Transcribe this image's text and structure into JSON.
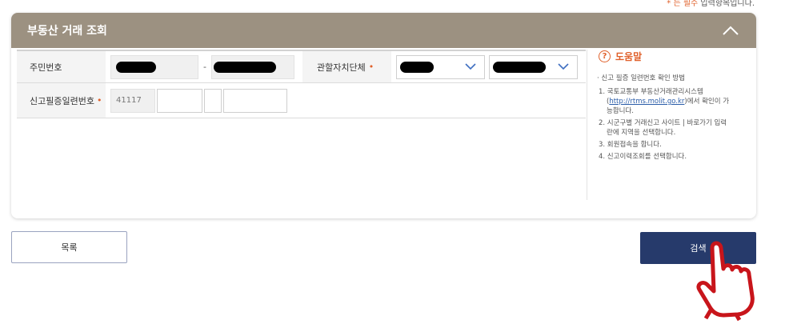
{
  "required_note": {
    "prefix": "* 는 ",
    "emphasis": "필수",
    "suffix": " 입력항목입니다."
  },
  "panel": {
    "title": "부동산 거래 조회"
  },
  "form": {
    "rrn_label": "주민번호",
    "rrn_dash": "-",
    "authority_label": "관할자치단체",
    "required_mark": "•",
    "report_label": "신고필증일련번호",
    "report_prefix_value": "41117"
  },
  "help": {
    "title": "도움말",
    "intro": "· 신고 필증 일련번호 확인 방법",
    "step1_a": "1. 국토교통부 부동산거래관리시스템",
    "step1_link": "http://rtms.molit.go.kr",
    "step1_b": "에서 확인이 가능합니다.",
    "step2": "2. 시군구별 거래신고 사이트 | 바로가기 입력란에 지역을 선택합니다.",
    "step3": "3. 회원접속을 합니다.",
    "step4": "4. 신고이력조회를 선택합니다."
  },
  "buttons": {
    "list": "목록",
    "search": "검색"
  },
  "colors": {
    "header": "#9c9181",
    "accent": "#e0602a",
    "search_button": "#263a6b",
    "hand_cursor": "#c8151b"
  }
}
